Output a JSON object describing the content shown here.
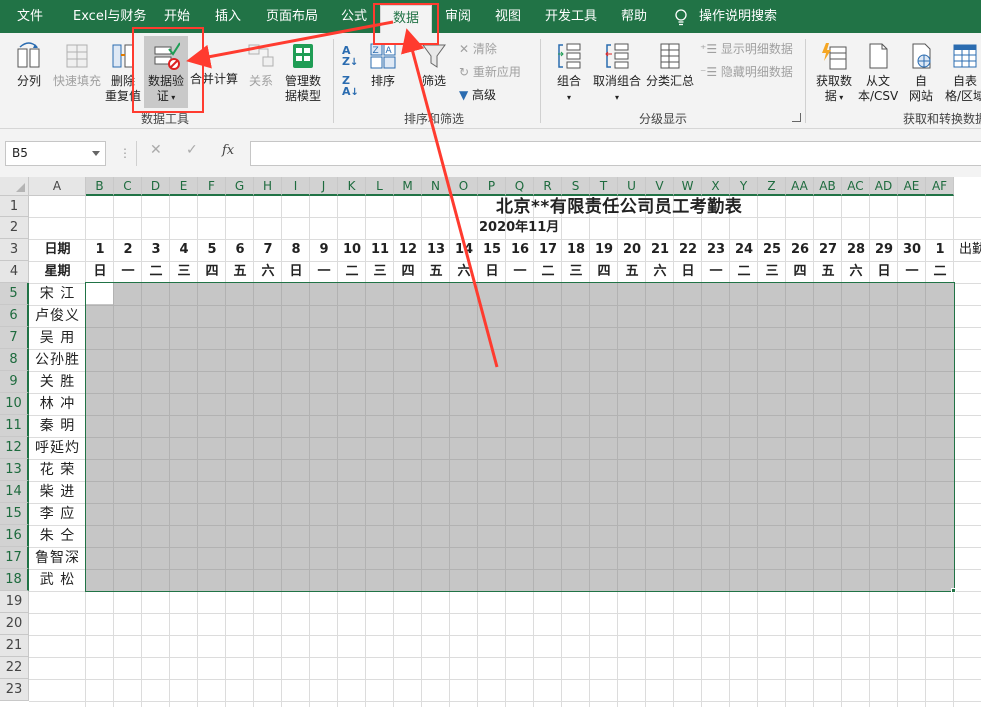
{
  "ribbon_tabs": [
    {
      "label": "文件"
    },
    {
      "label": "Excel与财务"
    },
    {
      "label": "开始"
    },
    {
      "label": "插入"
    },
    {
      "label": "页面布局"
    },
    {
      "label": "公式"
    },
    {
      "label": "数据",
      "active": true
    },
    {
      "label": "审阅"
    },
    {
      "label": "视图"
    },
    {
      "label": "开发工具"
    },
    {
      "label": "帮助"
    }
  ],
  "tell_me": "操作说明搜索",
  "groups": {
    "data_tools": {
      "label": "数据工具",
      "buttons": {
        "split": "分列",
        "flash_fill": "快速填充",
        "remove_dup_1": "删除",
        "remove_dup_2": "重复值",
        "validation_1": "数据验",
        "validation_2": "证",
        "consolidate": "合并计算",
        "relations": "关系",
        "data_model_1": "管理数",
        "data_model_2": "据模型"
      }
    },
    "sort_filter": {
      "label": "排序和筛选",
      "buttons": {
        "sort": "排序",
        "filter": "筛选",
        "clear": "清除",
        "reapply": "重新应用",
        "advanced": "高级"
      }
    },
    "outline": {
      "label": "分级显示",
      "buttons": {
        "group": "组合",
        "ungroup": "取消组合",
        "subtotal": "分类汇总",
        "show_detail": "显示明细数据",
        "hide_detail": "隐藏明细数据"
      }
    },
    "get_transform": {
      "label": "获取和转换数据",
      "buttons": {
        "get_data_1": "获取数",
        "get_data_2": "据",
        "from_text_1": "从文",
        "from_text_2": "本/CSV",
        "from_web_1": "自",
        "from_web_2": "网站",
        "from_table_1": "自表",
        "from_table_2": "格/区域"
      }
    }
  },
  "formula_bar": {
    "name_box": "B5",
    "fx": "fx",
    "formula": ""
  },
  "columns": [
    "A",
    "B",
    "C",
    "D",
    "E",
    "F",
    "G",
    "H",
    "I",
    "J",
    "K",
    "L",
    "M",
    "N",
    "O",
    "P",
    "Q",
    "R",
    "S",
    "T",
    "U",
    "V",
    "W",
    "X",
    "Y",
    "Z",
    "AA",
    "AB",
    "AC",
    "AD",
    "AE",
    "AF"
  ],
  "rows": [
    "1",
    "2",
    "3",
    "4",
    "5",
    "6",
    "7",
    "8",
    "9",
    "10",
    "11",
    "12",
    "13",
    "14",
    "15",
    "16",
    "17",
    "18",
    "19",
    "20",
    "21",
    "22",
    "23"
  ],
  "sheet": {
    "title": "北京**有限责任公司员工考勤表",
    "month": "2020年11月",
    "date_label": "日期",
    "weekday_label": "星期",
    "dates": [
      "1",
      "2",
      "3",
      "4",
      "5",
      "6",
      "7",
      "8",
      "9",
      "10",
      "11",
      "12",
      "13",
      "14",
      "15",
      "16",
      "17",
      "18",
      "19",
      "20",
      "21",
      "22",
      "23",
      "24",
      "25",
      "26",
      "27",
      "28",
      "29",
      "30",
      "1"
    ],
    "weekdays": [
      "日",
      "一",
      "二",
      "三",
      "四",
      "五",
      "六",
      "日",
      "一",
      "二",
      "三",
      "四",
      "五",
      "六",
      "日",
      "一",
      "二",
      "三",
      "四",
      "五",
      "六",
      "日",
      "一",
      "二",
      "三",
      "四",
      "五",
      "六",
      "日",
      "一",
      "二"
    ],
    "overflow_header": "出勤",
    "employees": [
      "宋 江",
      "卢俊义",
      "吴 用",
      "公孙胜",
      "关 胜",
      "林 冲",
      "秦 明",
      "呼延灼",
      "花 荣",
      "柴 进",
      "李 应",
      "朱 仝",
      "鲁智深",
      "武 松"
    ]
  },
  "colors": {
    "accent": "#217346",
    "annotation": "#ff3b2f",
    "selection": "#c6c6c6"
  }
}
